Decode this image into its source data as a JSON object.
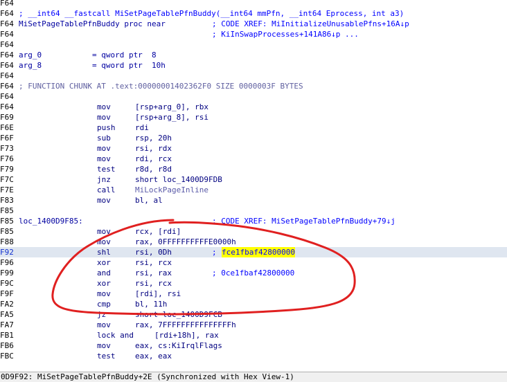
{
  "lines": [
    {
      "addr": "F64",
      "type": "blank"
    },
    {
      "addr": "F64",
      "type": "comment",
      "text": "; __int64 __fastcall MiSetPageTablePfnBuddy(__int64 mmPfn, __int64 Eprocess, int a3)"
    },
    {
      "addr": "F64",
      "type": "proc",
      "text": "MiSetPageTablePfnBuddy proc near",
      "comment": "; CODE XREF: MiInitializeUnusablePfns+16A↓p"
    },
    {
      "addr": "F64",
      "type": "xref",
      "comment": "; KiInSwapProcesses+141A86↓p ..."
    },
    {
      "addr": "F64",
      "type": "blank"
    },
    {
      "addr": "F64",
      "type": "var",
      "text": "arg_0           = qword ptr  8"
    },
    {
      "addr": "F64",
      "type": "var",
      "text": "arg_8           = qword ptr  10h"
    },
    {
      "addr": "F64",
      "type": "blank"
    },
    {
      "addr": "F64",
      "type": "chunk",
      "text": "; FUNCTION CHUNK AT .text:00000001402362F0 SIZE 0000003F BYTES"
    },
    {
      "addr": "F64",
      "type": "blank"
    },
    {
      "addr": "F64",
      "type": "ins",
      "mnem": "mov",
      "ops": "[rsp+arg_0], rbx"
    },
    {
      "addr": "F69",
      "type": "ins",
      "mnem": "mov",
      "ops": "[rsp+arg_8], rsi"
    },
    {
      "addr": "F6E",
      "type": "ins",
      "mnem": "push",
      "ops": "rdi"
    },
    {
      "addr": "F6F",
      "type": "ins",
      "mnem": "sub",
      "ops": "rsp, 20h"
    },
    {
      "addr": "F73",
      "type": "ins",
      "mnem": "mov",
      "ops": "rsi, rdx"
    },
    {
      "addr": "F76",
      "type": "ins",
      "mnem": "mov",
      "ops": "rdi, rcx"
    },
    {
      "addr": "F79",
      "type": "ins",
      "mnem": "test",
      "ops": "r8d, r8d"
    },
    {
      "addr": "F7C",
      "type": "ins",
      "mnem": "jnz",
      "ops": "short loc_1400D9FDB"
    },
    {
      "addr": "F7E",
      "type": "ins",
      "mnem": "call",
      "ops": "MiLockPageInline",
      "fn": true
    },
    {
      "addr": "F83",
      "type": "ins",
      "mnem": "mov",
      "ops": "bl, al"
    },
    {
      "addr": "F85",
      "type": "blank"
    },
    {
      "addr": "F85",
      "type": "label",
      "text": "loc_1400D9F85:",
      "comment": "; CODE XREF: MiSetPageTablePfnBuddy+79↓j"
    },
    {
      "addr": "F85",
      "type": "ins",
      "mnem": "mov",
      "ops": "rcx, [rdi]"
    },
    {
      "addr": "F88",
      "type": "ins",
      "mnem": "mov",
      "ops": "rax, 0FFFFFFFFFFE0000h"
    },
    {
      "addr": "F92",
      "type": "ins",
      "mnem": "shl",
      "ops": "rsi, 0Dh",
      "comment": "; ",
      "hcomment": "fce1fbaf42800000",
      "current": true
    },
    {
      "addr": "F96",
      "type": "ins",
      "mnem": "xor",
      "ops": "rsi, rcx"
    },
    {
      "addr": "F99",
      "type": "ins",
      "mnem": "and",
      "ops": "rsi, rax",
      "comment": "; 0ce1fbaf42800000"
    },
    {
      "addr": "F9C",
      "type": "ins",
      "mnem": "xor",
      "ops": "rsi, rcx"
    },
    {
      "addr": "F9F",
      "type": "ins",
      "mnem": "mov",
      "ops": "[rdi], rsi"
    },
    {
      "addr": "FA2",
      "type": "ins",
      "mnem": "cmp",
      "ops": "bl, 11h"
    },
    {
      "addr": "FA5",
      "type": "ins",
      "mnem": "jz",
      "ops": "short loc_1400D9FCB"
    },
    {
      "addr": "FA7",
      "type": "ins",
      "mnem": "mov",
      "ops": "rax, 7FFFFFFFFFFFFFFFh"
    },
    {
      "addr": "FB1",
      "type": "ins",
      "mnem": "lock and",
      "ops": "[rdi+18h], rax",
      "joined": true
    },
    {
      "addr": "FB6",
      "type": "ins",
      "mnem": "mov",
      "ops": "eax, cs:KiIrqlFlags"
    },
    {
      "addr": "FBC",
      "type": "ins",
      "mnem": "test",
      "ops": "eax, eax"
    }
  ],
  "status": "0D9F92: MiSetPageTablePfnBuddy+2E (Synchronized with Hex View-1)",
  "colors": {
    "annotation": "#e02020",
    "highlight": "#ffff00",
    "address": "#000000",
    "code": "#000080",
    "comment": "#0000ff"
  }
}
